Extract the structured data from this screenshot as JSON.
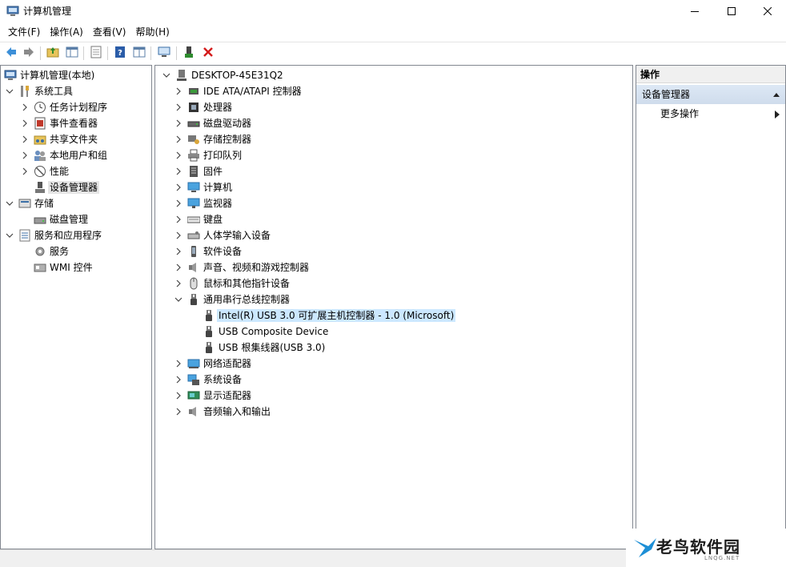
{
  "window": {
    "title": "计算机管理"
  },
  "window_controls": {
    "minimize_icon": "minimize-icon",
    "maximize_icon": "maximize-icon",
    "close_icon": "close-icon"
  },
  "menu": [
    "文件(F)",
    "操作(A)",
    "查看(V)",
    "帮助(H)"
  ],
  "toolbar": {
    "buttons": [
      "back-arrow-icon",
      "forward-arrow-icon",
      "up-folder-icon",
      "show-hide-tree-icon",
      "export-list-icon",
      "help-icon",
      "properties-icon",
      "scan-hardware-icon",
      "update-driver-icon",
      "uninstall-device-icon"
    ]
  },
  "left_tree": {
    "root": "计算机管理(本地)",
    "items": [
      {
        "label": "系统工具",
        "level": 1,
        "expander": "expanded",
        "icon": "tools-icon"
      },
      {
        "label": "任务计划程序",
        "level": 2,
        "expander": "collapsed",
        "icon": "clock-icon"
      },
      {
        "label": "事件查看器",
        "level": 2,
        "expander": "collapsed",
        "icon": "event-viewer-icon"
      },
      {
        "label": "共享文件夹",
        "level": 2,
        "expander": "collapsed",
        "icon": "shared-folder-icon"
      },
      {
        "label": "本地用户和组",
        "level": 2,
        "expander": "collapsed",
        "icon": "users-icon"
      },
      {
        "label": "性能",
        "level": 2,
        "expander": "collapsed",
        "icon": "performance-icon"
      },
      {
        "label": "设备管理器",
        "level": 2,
        "expander": "none",
        "icon": "device-manager-icon",
        "selected": true
      },
      {
        "label": "存储",
        "level": 1,
        "expander": "expanded",
        "icon": "storage-icon"
      },
      {
        "label": "磁盘管理",
        "level": 2,
        "expander": "none",
        "icon": "disk-icon"
      },
      {
        "label": "服务和应用程序",
        "level": 1,
        "expander": "expanded",
        "icon": "services-apps-icon"
      },
      {
        "label": "服务",
        "level": 2,
        "expander": "none",
        "icon": "services-icon"
      },
      {
        "label": "WMI 控件",
        "level": 2,
        "expander": "none",
        "icon": "wmi-icon"
      }
    ]
  },
  "device_tree": {
    "root": "DESKTOP-45E31Q2",
    "items": [
      {
        "label": "IDE ATA/ATAPI 控制器",
        "level": 1,
        "expander": "collapsed",
        "icon": "ide-controller-icon"
      },
      {
        "label": "处理器",
        "level": 1,
        "expander": "collapsed",
        "icon": "processor-icon"
      },
      {
        "label": "磁盘驱动器",
        "level": 1,
        "expander": "collapsed",
        "icon": "disk-drive-icon"
      },
      {
        "label": "存储控制器",
        "level": 1,
        "expander": "collapsed",
        "icon": "storage-controller-icon"
      },
      {
        "label": "打印队列",
        "level": 1,
        "expander": "collapsed",
        "icon": "printer-icon"
      },
      {
        "label": "固件",
        "level": 1,
        "expander": "collapsed",
        "icon": "firmware-icon"
      },
      {
        "label": "计算机",
        "level": 1,
        "expander": "collapsed",
        "icon": "computer-icon"
      },
      {
        "label": "监视器",
        "level": 1,
        "expander": "collapsed",
        "icon": "monitor-icon"
      },
      {
        "label": "键盘",
        "level": 1,
        "expander": "collapsed",
        "icon": "keyboard-icon"
      },
      {
        "label": "人体学输入设备",
        "level": 1,
        "expander": "collapsed",
        "icon": "hid-icon"
      },
      {
        "label": "软件设备",
        "level": 1,
        "expander": "collapsed",
        "icon": "software-device-icon"
      },
      {
        "label": "声音、视频和游戏控制器",
        "level": 1,
        "expander": "collapsed",
        "icon": "speaker-icon"
      },
      {
        "label": "鼠标和其他指针设备",
        "level": 1,
        "expander": "collapsed",
        "icon": "mouse-icon"
      },
      {
        "label": "通用串行总线控制器",
        "level": 1,
        "expander": "expanded",
        "icon": "usb-icon"
      },
      {
        "label": "Intel(R) USB 3.0 可扩展主机控制器 - 1.0 (Microsoft)",
        "level": 2,
        "expander": "none",
        "icon": "usb-icon",
        "selected": true
      },
      {
        "label": "USB Composite Device",
        "level": 2,
        "expander": "none",
        "icon": "usb-icon"
      },
      {
        "label": "USB 根集线器(USB 3.0)",
        "level": 2,
        "expander": "none",
        "icon": "usb-icon"
      },
      {
        "label": "网络适配器",
        "level": 1,
        "expander": "collapsed",
        "icon": "network-adapter-icon"
      },
      {
        "label": "系统设备",
        "level": 1,
        "expander": "collapsed",
        "icon": "system-device-icon"
      },
      {
        "label": "显示适配器",
        "level": 1,
        "expander": "collapsed",
        "icon": "display-adapter-icon"
      },
      {
        "label": "音频输入和输出",
        "level": 1,
        "expander": "collapsed",
        "icon": "speaker-icon"
      }
    ]
  },
  "actions": {
    "header": "操作",
    "section": "设备管理器",
    "items": [
      "更多操作"
    ]
  },
  "watermark": {
    "text": "老鸟软件园",
    "sub": "LNQG.NET"
  },
  "colors": {
    "selection_blue": "#cce8ff",
    "selection_gray": "#e5e5e5",
    "close_red": "#e81123",
    "actions_section": "#d6e2f0"
  }
}
